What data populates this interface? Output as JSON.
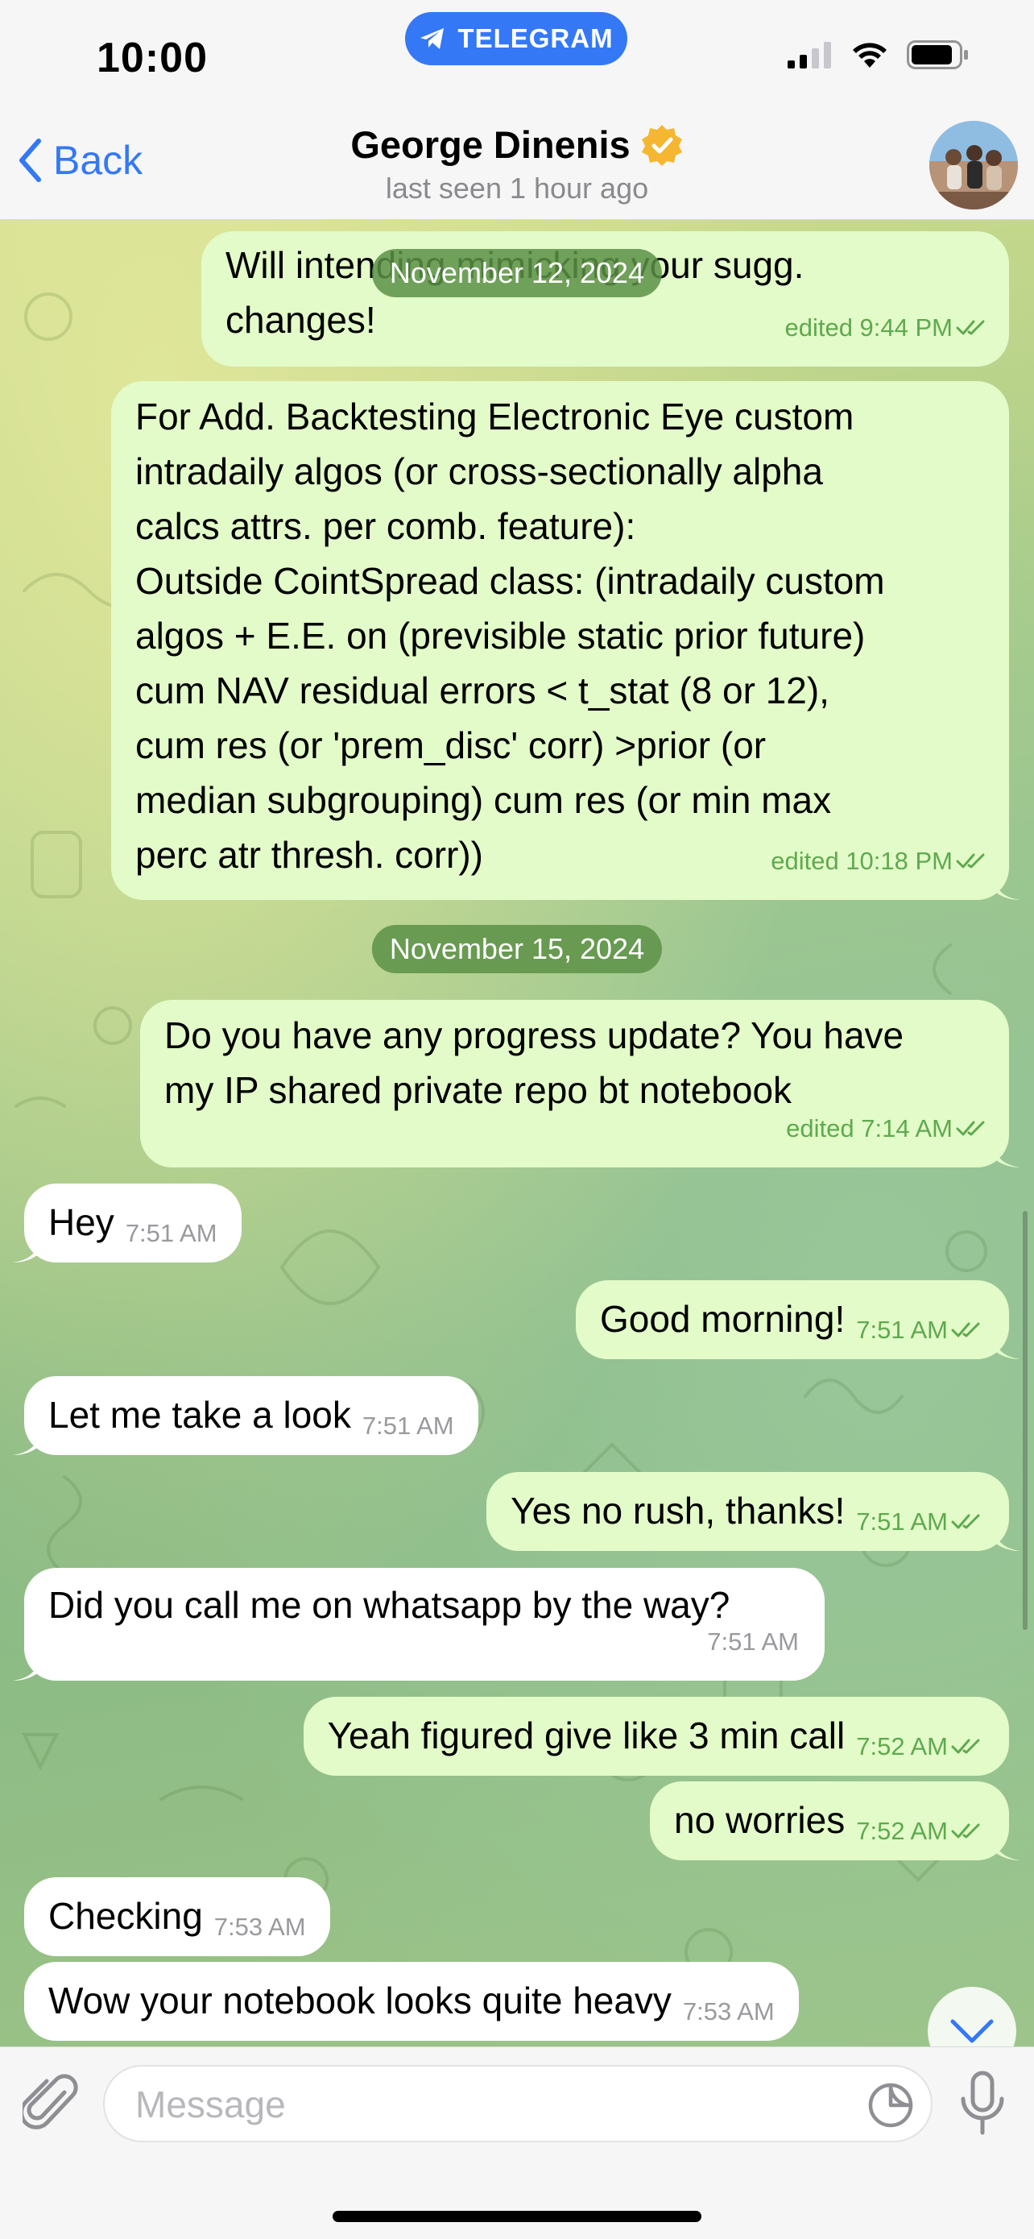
{
  "status_bar": {
    "time": "10:00",
    "app_pill": "TELEGRAM",
    "icons": [
      "signal-icon",
      "wifi-icon",
      "battery-icon"
    ]
  },
  "header": {
    "back_label": "Back",
    "contact_name": "George Dinenis",
    "verified": true,
    "last_seen": "last seen 1 hour ago"
  },
  "colors": {
    "outgoing_bubble": "#e3fbc9",
    "incoming_bubble": "#ffffff",
    "accent": "#3478f6",
    "outgoing_meta": "#5fa94f",
    "date_pill": "#5c9146"
  },
  "dates": {
    "d1": "November 12, 2024",
    "d2": "November 15, 2024"
  },
  "messages": [
    {
      "direction": "out",
      "text": "Will intending mimicking your sugg.\nchanges!",
      "time": "edited 9:44 PM",
      "read": true
    },
    {
      "direction": "out",
      "text": "For Add. Backtesting Electronic Eye custom\nintradaily algos (or cross-sectionally alpha\ncalcs attrs. per comb. feature):\nOutside CointSpread class: (intradaily custom\nalgos + E.E. on (previsible static prior future)\ncum NAV residual errors < t_stat (8 or 12),\ncum res (or 'prem_disc' corr) >prior (or\nmedian subgrouping) cum res (or min max\nperc atr thresh. corr))",
      "time": "edited 10:18 PM",
      "read": true
    },
    {
      "direction": "out",
      "text": "Do you have any progress update? You have\nmy IP shared private repo bt notebook",
      "time": "edited 7:14 AM",
      "read": true
    },
    {
      "direction": "in",
      "text": "Hey",
      "time": "7:51 AM"
    },
    {
      "direction": "out",
      "text": "Good morning!",
      "time": "7:51 AM",
      "read": true
    },
    {
      "direction": "in",
      "text": "Let me take a look",
      "time": "7:51 AM"
    },
    {
      "direction": "out",
      "text": "Yes no rush, thanks!",
      "time": "7:51 AM",
      "read": true
    },
    {
      "direction": "in",
      "text": "Did you call me on whatsapp by the way?",
      "time": "7:51 AM"
    },
    {
      "direction": "out",
      "text": "Yeah figured give like 3 min call",
      "time": "7:52 AM",
      "read": true
    },
    {
      "direction": "out",
      "text": "no worries",
      "time": "7:52 AM",
      "read": true
    },
    {
      "direction": "in",
      "text": "Checking",
      "time": "7:53 AM"
    },
    {
      "direction": "in",
      "text": "Wow your notebook looks quite heavy",
      "time": "7:53 AM"
    }
  ],
  "composer": {
    "placeholder": "Message"
  }
}
